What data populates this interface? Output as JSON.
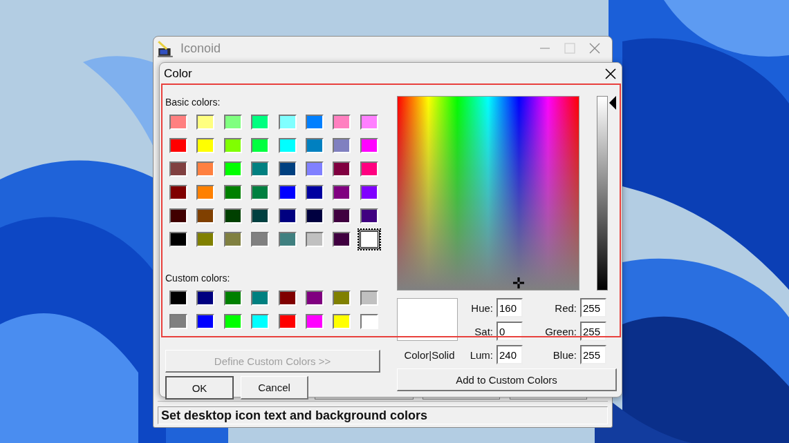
{
  "app_window": {
    "title": "Iconoid",
    "status_bar": "Set desktop icon text and background colors"
  },
  "dialog": {
    "title": "Color",
    "highlighted": true,
    "basic_label": "Basic colors:",
    "basic_colors": [
      {
        "color": "#ff8080",
        "selected": false
      },
      {
        "color": "#ffff80",
        "selected": false
      },
      {
        "color": "#80ff80",
        "selected": false
      },
      {
        "color": "#00ff80",
        "selected": false
      },
      {
        "color": "#80ffff",
        "selected": false
      },
      {
        "color": "#0080ff",
        "selected": false
      },
      {
        "color": "#ff80c0",
        "selected": false
      },
      {
        "color": "#ff80ff",
        "selected": false
      },
      {
        "color": "#ff0000",
        "selected": false
      },
      {
        "color": "#ffff00",
        "selected": false
      },
      {
        "color": "#80ff00",
        "selected": false
      },
      {
        "color": "#00ff40",
        "selected": false
      },
      {
        "color": "#00ffff",
        "selected": false
      },
      {
        "color": "#0080c0",
        "selected": false
      },
      {
        "color": "#8080c0",
        "selected": false
      },
      {
        "color": "#ff00ff",
        "selected": false
      },
      {
        "color": "#804040",
        "selected": false
      },
      {
        "color": "#ff8040",
        "selected": false
      },
      {
        "color": "#00ff00",
        "selected": false
      },
      {
        "color": "#008080",
        "selected": false
      },
      {
        "color": "#004080",
        "selected": false
      },
      {
        "color": "#8080ff",
        "selected": false
      },
      {
        "color": "#800040",
        "selected": false
      },
      {
        "color": "#ff0080",
        "selected": false
      },
      {
        "color": "#800000",
        "selected": false
      },
      {
        "color": "#ff8000",
        "selected": false
      },
      {
        "color": "#008000",
        "selected": false
      },
      {
        "color": "#008040",
        "selected": false
      },
      {
        "color": "#0000ff",
        "selected": false
      },
      {
        "color": "#0000a0",
        "selected": false
      },
      {
        "color": "#800080",
        "selected": false
      },
      {
        "color": "#8000ff",
        "selected": false
      },
      {
        "color": "#400000",
        "selected": false
      },
      {
        "color": "#804000",
        "selected": false
      },
      {
        "color": "#004000",
        "selected": false
      },
      {
        "color": "#004040",
        "selected": false
      },
      {
        "color": "#000080",
        "selected": false
      },
      {
        "color": "#000040",
        "selected": false
      },
      {
        "color": "#400040",
        "selected": false
      },
      {
        "color": "#400080",
        "selected": false
      },
      {
        "color": "#000000",
        "selected": false
      },
      {
        "color": "#808000",
        "selected": false
      },
      {
        "color": "#808040",
        "selected": false
      },
      {
        "color": "#808080",
        "selected": false
      },
      {
        "color": "#408080",
        "selected": false
      },
      {
        "color": "#c0c0c0",
        "selected": false
      },
      {
        "color": "#400040",
        "selected": false
      },
      {
        "color": "#ffffff",
        "selected": true
      }
    ],
    "custom_label": "Custom colors:",
    "custom_colors": [
      {
        "color": "#000000"
      },
      {
        "color": "#000080"
      },
      {
        "color": "#008000"
      },
      {
        "color": "#008080"
      },
      {
        "color": "#800000"
      },
      {
        "color": "#800080"
      },
      {
        "color": "#808000"
      },
      {
        "color": "#c0c0c0"
      },
      {
        "color": "#808080"
      },
      {
        "color": "#0000ff"
      },
      {
        "color": "#00ff00"
      },
      {
        "color": "#00ffff"
      },
      {
        "color": "#ff0000"
      },
      {
        "color": "#ff00ff"
      },
      {
        "color": "#ffff00"
      },
      {
        "color": "#ffffff"
      }
    ],
    "define_button": {
      "label": "Define Custom Colors >>",
      "disabled": true
    },
    "ok_button": "OK",
    "cancel_button": "Cancel",
    "luminance_slider": {
      "level": 1
    },
    "preview_label": "Color|Solid",
    "fields": [
      {
        "label": "Hue:",
        "value": "160"
      },
      {
        "label": "Red:",
        "value": "255"
      },
      {
        "label": "Sat:",
        "value": "0"
      },
      {
        "label": "Green:",
        "value": "255"
      },
      {
        "label": "Lum:",
        "value": "240"
      },
      {
        "label": "Blue:",
        "value": "255"
      }
    ],
    "add_button": "Add to Custom Colors"
  }
}
